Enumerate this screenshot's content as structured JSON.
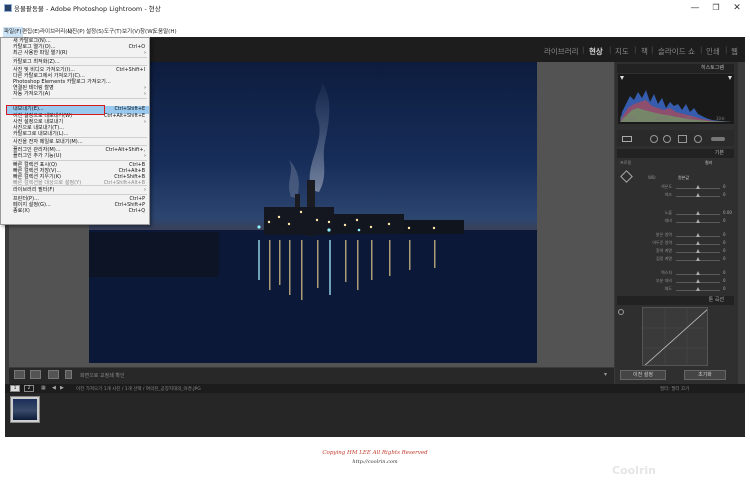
{
  "window": {
    "title": "웅물팥동물 - Adobe Photoshop Lightroom - 현상",
    "minimize": "—",
    "maximize": "❐",
    "close": "✕"
  },
  "menubar": [
    "파일(F)",
    "편집(E)",
    "라이브러리(L)",
    "사진(P)",
    "설정(S)",
    "도구(T)",
    "보기(V)",
    "창(W)",
    "도움말(H)"
  ],
  "modules": [
    "라이브러리",
    "현상",
    "지도",
    "책",
    "슬라이드 쇼",
    "인쇄",
    "웹"
  ],
  "file_menu": [
    {
      "label": "새 카탈로그(N)...",
      "shortcut": "",
      "disabled": false,
      "submenu": false
    },
    {
      "label": "카탈로그 열기(O)...",
      "shortcut": "Ctrl+O",
      "disabled": false,
      "submenu": false
    },
    {
      "label": "최근 사용한 파일 열기(R)",
      "shortcut": "",
      "disabled": false,
      "submenu": true
    },
    {
      "label": "카탈로그 최적화(Z)...",
      "shortcut": "",
      "disabled": false,
      "submenu": false
    },
    {
      "label": "사진 및 비디오 가져오기(I)...",
      "shortcut": "Ctrl+Shift+I",
      "disabled": false,
      "submenu": false
    },
    {
      "label": "다른 카탈로그에서 가져오기(C)...",
      "shortcut": "",
      "disabled": false,
      "submenu": false
    },
    {
      "label": "Photoshop Elements 카탈로그 가져오기...",
      "shortcut": "",
      "disabled": false,
      "submenu": false
    },
    {
      "label": "연결된 테더링 촬영",
      "shortcut": "",
      "disabled": false,
      "submenu": true
    },
    {
      "label": "자동 가져오기(A)",
      "shortcut": "",
      "disabled": false,
      "submenu": true
    },
    {
      "label": "내보내기(E)...",
      "shortcut": "Ctrl+Shift+E",
      "disabled": false,
      "submenu": false
    },
    {
      "label": "이전 설정으로 내보내기(W)",
      "shortcut": "Ctrl+Alt+Shift+E",
      "disabled": false,
      "submenu": false
    },
    {
      "label": "사전 설정으로 내보내기",
      "shortcut": "",
      "disabled": false,
      "submenu": true
    },
    {
      "label": "사진으로 내보내기(T)...",
      "shortcut": "",
      "disabled": false,
      "submenu": false
    },
    {
      "label": "카탈로그로 내보내기(L)...",
      "shortcut": "",
      "disabled": false,
      "submenu": false
    },
    {
      "label": "사진을 전자 메일로 보내기(M)...",
      "shortcut": "",
      "disabled": false,
      "submenu": false
    },
    {
      "label": "플러그인 관리자(M)...",
      "shortcut": "Ctrl+Alt+Shift+,",
      "disabled": false,
      "submenu": false
    },
    {
      "label": "플러그인 추가 기능(U)",
      "shortcut": "",
      "disabled": false,
      "submenu": true
    },
    {
      "label": "빠른 컬렉션 표시(Q)",
      "shortcut": "Ctrl+B",
      "disabled": false,
      "submenu": false
    },
    {
      "label": "빠른 컬렉션 저장(V)...",
      "shortcut": "Ctrl+Alt+B",
      "disabled": false,
      "submenu": false
    },
    {
      "label": "빠른 컬렉션 지우기(K)",
      "shortcut": "Ctrl+Shift+B",
      "disabled": false,
      "submenu": false
    },
    {
      "label": "빠른 컬렉션을 대상으로 설정(Y)",
      "shortcut": "Ctrl+Shift+Alt+B",
      "disabled": true,
      "submenu": false
    },
    {
      "label": "라이브러리 필터(F)",
      "shortcut": "",
      "disabled": false,
      "submenu": true
    },
    {
      "label": "프린터(P)...",
      "shortcut": "Ctrl+P",
      "disabled": false,
      "submenu": false
    },
    {
      "label": "페이지 설정(G)...",
      "shortcut": "Ctrl+Shift+P",
      "disabled": false,
      "submenu": false
    },
    {
      "label": "종료(X)",
      "shortcut": "Ctrl+Q",
      "disabled": false,
      "submenu": false
    }
  ],
  "panels": {
    "histogram": "히스토그램",
    "basic": "기본",
    "tone_curve": "톤 곡선",
    "hist_info": [
      "ISO 100",
      "28mm",
      "f/11",
      "30초"
    ],
    "profile_label": "프로필",
    "profile_value": "컬러",
    "wb_label": "WB:",
    "wb_value": "원본값",
    "sliders": [
      {
        "label": "색온도",
        "value": "0"
      },
      {
        "label": "색조",
        "value": "0"
      },
      {
        "label": "노출",
        "value": "0.00"
      },
      {
        "label": "대비",
        "value": "0"
      },
      {
        "label": "밝은 영역",
        "value": "0"
      },
      {
        "label": "어두운 영역",
        "value": "0"
      },
      {
        "label": "흰색 계열",
        "value": "0"
      },
      {
        "label": "검정 계열",
        "value": "0"
      },
      {
        "label": "텍스처",
        "value": "0"
      },
      {
        "label": "부분 대비",
        "value": "0"
      },
      {
        "label": "채도",
        "value": "0"
      }
    ],
    "prev_button": "이전 설정",
    "reset_button": "초기화"
  },
  "toolbar": {
    "text": "화면으로 교정쇄 확인"
  },
  "filmstrip": {
    "page1": "1",
    "page2": "2",
    "path": "이전 가져오기  1개 사진 / 1개 선택 / 여의천_공장지대의_야경.JPG",
    "filter": "필터:  필터 끄기"
  },
  "footer": {
    "copyright": "Copying HM LEE All Rights Reserved",
    "url": "http://coolrin.com"
  },
  "colors": {
    "highlight_red": "#d41a1a",
    "menu_highlight": "#99c9ef"
  }
}
